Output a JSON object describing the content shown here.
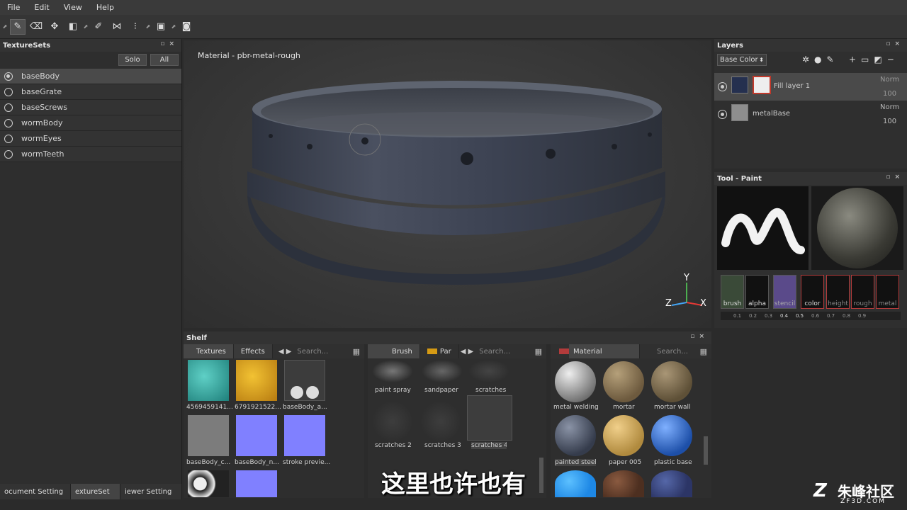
{
  "menu": [
    "File",
    "Edit",
    "View",
    "Help"
  ],
  "texturesets": {
    "title": "TextureSets",
    "solo": "Solo",
    "all": "All",
    "items": [
      "baseBody",
      "baseGrate",
      "baseScrews",
      "wormBody",
      "wormEyes",
      "wormTeeth"
    ],
    "selected": "baseBody"
  },
  "bottom_tabs": [
    "ocument Setting",
    "extureSet",
    "iewer Setting"
  ],
  "viewport": {
    "material_label": "Material - pbr-metal-rough",
    "axis": {
      "y": "Y",
      "z": "Z",
      "x": "X"
    }
  },
  "shelf": {
    "title": "Shelf",
    "left": {
      "tabs": [
        "Textures",
        "Effects"
      ],
      "search": "Search...",
      "items": [
        "4569459141...",
        "6791921522...",
        "baseBody_a...",
        "baseBody_c...",
        "baseBody_n...",
        "stroke previe..."
      ]
    },
    "middle": {
      "tabs": [
        "Brush",
        "Par"
      ],
      "search": "Search...",
      "items": [
        "paint spray",
        "sandpaper",
        "scratches",
        "scratches 2",
        "scratches 3",
        "scratches 4"
      ]
    },
    "right": {
      "tab": "Material",
      "search": "Search...",
      "items": [
        "metal welding",
        "mortar",
        "mortar wall",
        "painted steel",
        "paper 005",
        "plastic base"
      ]
    }
  },
  "layers": {
    "title": "Layers",
    "channel": "Base Color",
    "items": [
      {
        "name": "Fill layer 1",
        "blend": "Norm",
        "opacity": "100"
      },
      {
        "name": "metalBase",
        "blend": "Norm",
        "opacity": "100"
      }
    ]
  },
  "tool": {
    "title": "Tool - Paint",
    "channels": [
      "brush",
      "alpha",
      "stencil",
      "color",
      "height",
      "rough",
      "metal"
    ],
    "scale": [
      "0.1",
      "0.2",
      "0.3",
      "0.4",
      "0.5",
      "0.6",
      "0.7",
      "0.8",
      "0.9"
    ]
  },
  "subtitle": "这里也许也有",
  "watermark": {
    "name": "朱峰社区",
    "url": "ZF3D.COM"
  },
  "colors": {
    "accent_red": "#b33b3b",
    "selected_row": "#4a4a4a",
    "layer_swatch": "#25304f"
  }
}
